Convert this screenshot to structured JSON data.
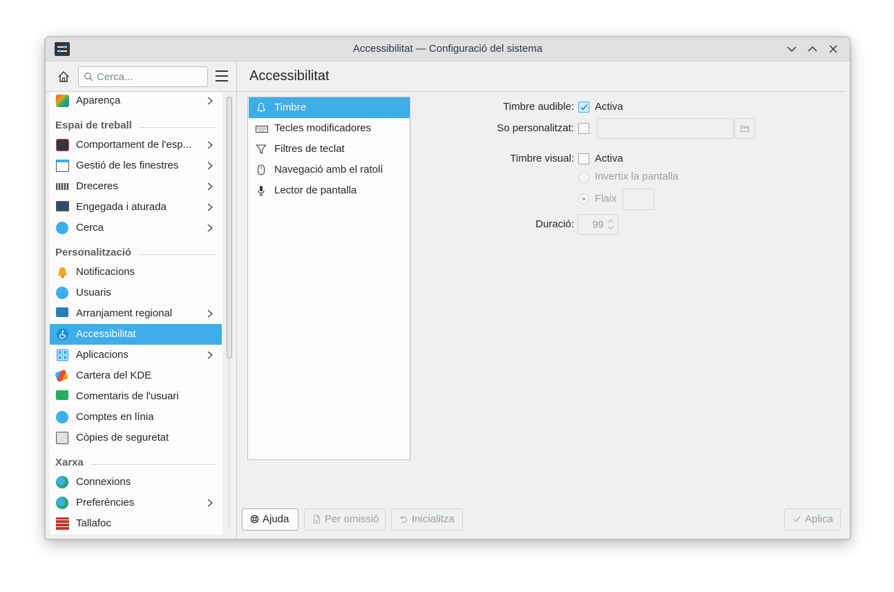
{
  "window": {
    "title": "Accessibilitat — Configuració del sistema"
  },
  "search": {
    "placeholder": "Cerca..."
  },
  "sidebar": {
    "top_item": {
      "label": "Aparença"
    },
    "sections": {
      "workspace": "Espai de treball",
      "personalization": "Personalització",
      "network": "Xarxa"
    },
    "workspace_items": [
      {
        "label": "Comportament de l'esp..."
      },
      {
        "label": "Gestió de les finestres"
      },
      {
        "label": "Dreceres"
      },
      {
        "label": "Engegada i aturada"
      },
      {
        "label": "Cerca"
      }
    ],
    "personalization_items": [
      {
        "label": "Notificacions"
      },
      {
        "label": "Usuaris"
      },
      {
        "label": "Arranjament regional"
      },
      {
        "label": "Accessibilitat"
      },
      {
        "label": "Aplicacions"
      },
      {
        "label": "Cartera del KDE"
      },
      {
        "label": "Comentaris de l'usuari"
      },
      {
        "label": "Comptes en línia"
      },
      {
        "label": "Còpies de seguretat"
      }
    ],
    "network_items": [
      {
        "label": "Connexions"
      },
      {
        "label": "Preferències"
      },
      {
        "label": "Tallafoc"
      }
    ],
    "selected": "Accessibilitat"
  },
  "page": {
    "title": "Accessibilitat"
  },
  "tabs": [
    {
      "label": "Timbre",
      "icon": "bell-icon"
    },
    {
      "label": "Tecles modificadores",
      "icon": "keyboard-icon"
    },
    {
      "label": "Filtres de teclat",
      "icon": "filter-icon"
    },
    {
      "label": "Navegació amb el ratolí",
      "icon": "mouse-icon"
    },
    {
      "label": "Lector de pantalla",
      "icon": "microphone-icon"
    }
  ],
  "bell_form": {
    "audible_label": "Timbre audible:",
    "audible_option": "Activa",
    "audible_checked": true,
    "custom_sound_label": "So personalitzat:",
    "custom_sound_checked": false,
    "custom_sound_path": "",
    "visual_label": "Timbre visual:",
    "visual_option": "Activa",
    "visual_checked": false,
    "invert_label": "Invertix la pantalla",
    "flash_label": "Flaix",
    "duration_label": "Duració:",
    "duration_value": "99"
  },
  "footer": {
    "help": "Ajuda",
    "defaults": "Per omissió",
    "reset": "Inicialitza",
    "apply": "Aplica"
  },
  "colors": {
    "accent": "#3daee9",
    "window_bg": "#eff0f1",
    "view_bg": "#fcfcfc",
    "text": "#232629"
  }
}
